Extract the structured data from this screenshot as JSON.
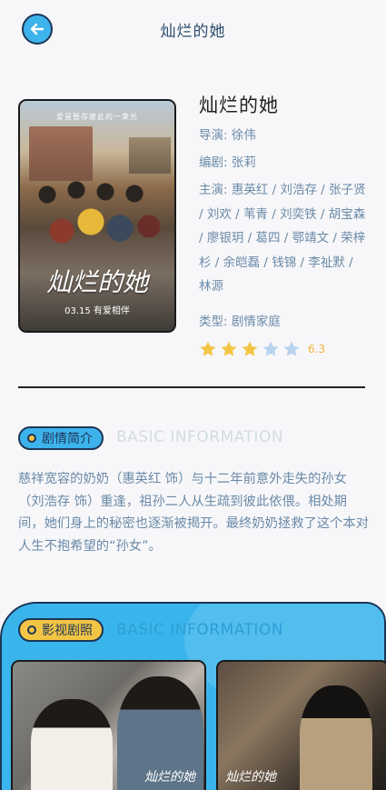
{
  "header": {
    "back_icon": "arrow-left-icon",
    "title": "灿烂的她"
  },
  "poster": {
    "tagline": "爱是暂存彼此的一束光",
    "title_art": "灿烂的她",
    "release": "03.15 有爱相伴"
  },
  "movie": {
    "title": "灿烂的她",
    "director": "导演: 徐伟",
    "writer": "编剧: 张莉",
    "cast": "主演: 惠英红 / 刘浩存 / 张子贤 / 刘欢 / 苇青 / 刘奕铁 / 胡宝森 / 廖银玥 / 葛四 / 鄂靖文 / 荣梓杉 / 余皑磊 / 钱锦 / 李祉默 / 林源",
    "genre": "类型: 剧情家庭",
    "rating": {
      "score": "6.3",
      "filled_stars": 3,
      "total_stars": 5,
      "star_color": "#f3c544",
      "empty_star_color": "#b9d3ee"
    }
  },
  "synopsis_section": {
    "label": "剧情简介",
    "english": "BASIC INFORMATION",
    "text": "慈祥宽容的奶奶（惠英红 饰）与十二年前意外走失的孙女（刘浩存 饰）重逢，祖孙二人从生疏到彼此依偎。相处期间，她们身上的秘密也逐渐被揭开。最终奶奶拯救了这个本对人生不抱希望的“孙女”。"
  },
  "stills_section": {
    "label": "影视剧照",
    "english": "BASIC INFORMATION",
    "watermark": "灿烂的她"
  },
  "colors": {
    "accent_blue": "#3db3ec",
    "navy": "#1d3557",
    "text_blue": "#6a8aa8",
    "pill_yellow": "#f3c544"
  }
}
